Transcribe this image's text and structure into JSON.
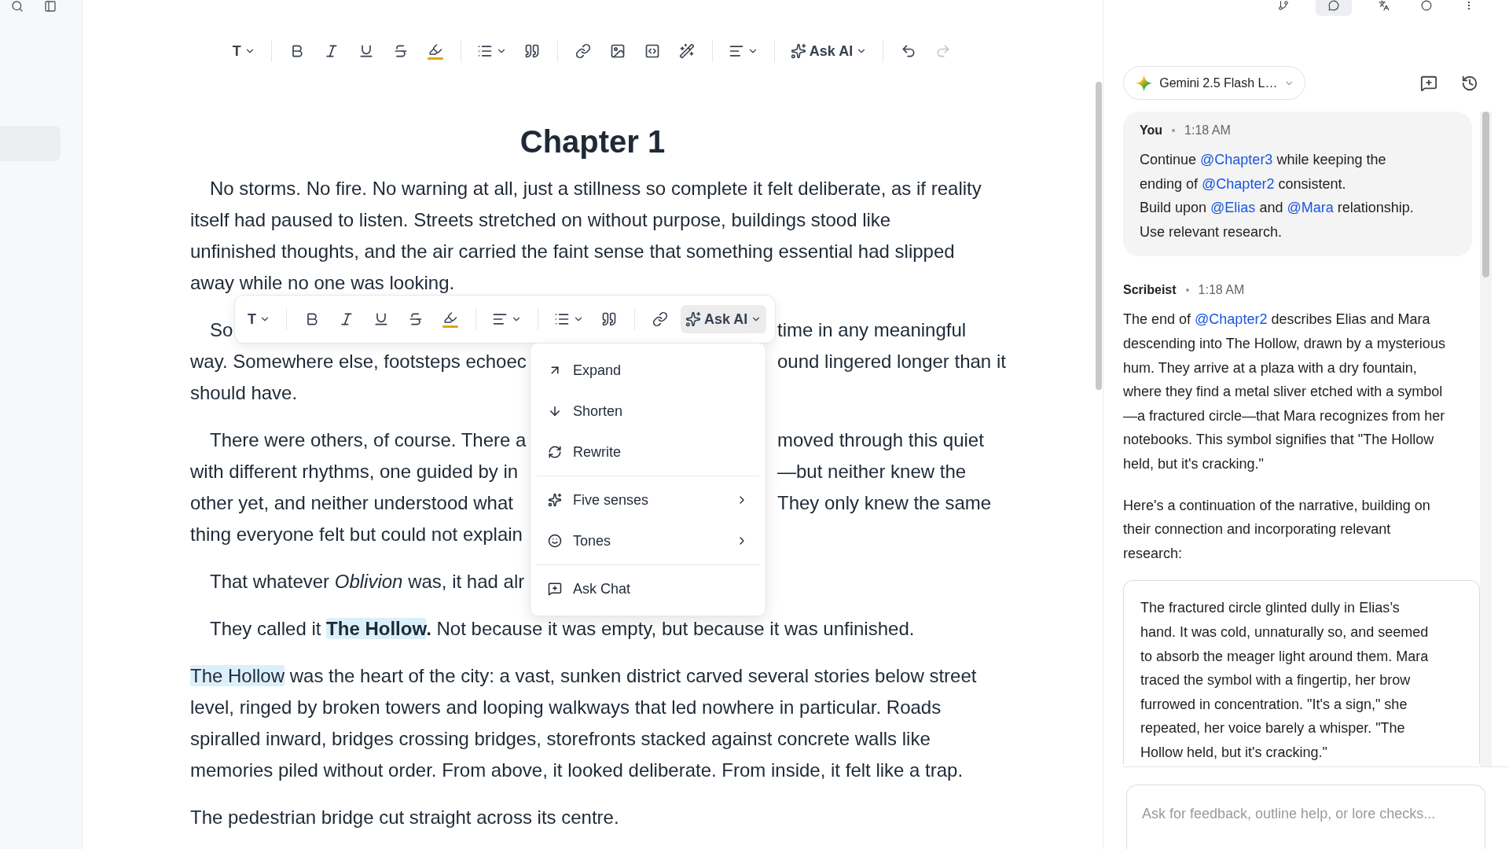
{
  "sidebar": {
    "items": [
      {
        "selected": true
      }
    ]
  },
  "top_icons": [
    {
      "kind": "branch",
      "selected": false
    },
    {
      "kind": "chat",
      "selected": true
    },
    {
      "kind": "text",
      "selected": false
    },
    {
      "kind": "circle",
      "selected": false
    },
    {
      "kind": "more",
      "selected": false
    }
  ],
  "toolbar": {
    "groups": [
      [
        {
          "kind": "text_style",
          "label": "T",
          "dropdown": true
        }
      ],
      [
        {
          "kind": "bold"
        },
        {
          "kind": "italic"
        },
        {
          "kind": "underline"
        },
        {
          "kind": "strike"
        },
        {
          "kind": "highlight"
        }
      ],
      [
        {
          "kind": "list",
          "dropdown": true
        },
        {
          "kind": "quote"
        }
      ],
      [
        {
          "kind": "link"
        },
        {
          "kind": "image"
        },
        {
          "kind": "code"
        },
        {
          "kind": "wand"
        }
      ],
      [
        {
          "kind": "align",
          "dropdown": true
        }
      ],
      [
        {
          "kind": "ask_ai",
          "label": "Ask AI",
          "dropdown": true,
          "selected": false
        }
      ],
      [
        {
          "kind": "undo",
          "disabled": false
        },
        {
          "kind": "redo",
          "disabled": true
        }
      ]
    ]
  },
  "document": {
    "title": "Chapter 1",
    "paragraphs": [
      {
        "kind": "full",
        "indent": true,
        "lines": [
          [
            {
              "text": "No storms. No fire. No warning at all, just a stillness so complete it felt deliberate, as if reality",
              "highlighted": false
            }
          ],
          [
            {
              "text": "itself had paused to listen. Streets stretched on without purpose, buildings stood like",
              "highlighted": false
            }
          ],
          [
            {
              "text": "unfinished thoughts, and the air carried the faint sense that something essential had slipped",
              "highlighted": false
            }
          ],
          [
            {
              "text": "away while no one was looking.",
              "highlighted": false
            }
          ]
        ]
      },
      {
        "kind": "covered",
        "indent": true,
        "lines": [
          {
            "left": "So",
            "right": "time in any meaningful"
          },
          {
            "left": "way. Somewhere else, footsteps echoec",
            "right": "ound lingered longer than it"
          },
          {
            "left": "should have."
          }
        ]
      },
      {
        "kind": "covered",
        "indent": true,
        "lines": [
          {
            "left": "There were others, of course. There a",
            "right": "moved through this quiet"
          },
          {
            "left": "with different rhythms, one guided by in",
            "right": "—but neither knew the"
          },
          {
            "left": "other yet, and neither understood what",
            "right": "They only knew the same"
          },
          {
            "left": "thing everyone felt but could not explain"
          }
        ]
      },
      {
        "kind": "covered",
        "indent": true,
        "lines": [
          {
            "left": "That whatever *Oblivion* was, it had alr"
          }
        ]
      },
      {
        "kind": "full",
        "indent": true,
        "lines": [
          [
            {
              "text": "They called it ",
              "highlighted": false
            },
            {
              "text": "**The Hollow**",
              "highlighted": true
            },
            {
              "text": "**.** Not because it was empty, but because it was unfinished.",
              "highlighted": false
            }
          ]
        ]
      },
      {
        "kind": "full",
        "indent": false,
        "lines": [
          [
            {
              "text": "The Hollow",
              "highlighted": true
            },
            {
              "text": " was the heart of the city: a vast, sunken district carved several stories below street",
              "highlighted": false
            }
          ],
          [
            {
              "text": "level, ringed by broken towers and looping walkways that led nowhere in particular. Roads",
              "highlighted": false
            }
          ],
          [
            {
              "text": "spiralled inward, bridges crossing bridges, storefronts stacked against concrete walls like",
              "highlighted": false
            }
          ],
          [
            {
              "text": "memories piled without order. From above, it looked deliberate. From inside, it felt like a trap.",
              "highlighted": false
            }
          ]
        ]
      },
      {
        "kind": "full",
        "indent": false,
        "lines": [
          [
            {
              "text": "The pedestrian bridge cut straight across its centre.",
              "highlighted": false
            }
          ]
        ]
      }
    ]
  },
  "floating_toolbar": {
    "groups": [
      [
        {
          "kind": "text_style",
          "label": "T",
          "dropdown": true
        }
      ],
      [
        {
          "kind": "bold"
        },
        {
          "kind": "italic"
        },
        {
          "kind": "underline"
        },
        {
          "kind": "strike"
        },
        {
          "kind": "highlight"
        }
      ],
      [
        {
          "kind": "align",
          "dropdown": true
        }
      ],
      [
        {
          "kind": "list",
          "dropdown": true
        },
        {
          "kind": "quote"
        }
      ],
      [
        {
          "kind": "link"
        },
        {
          "kind": "ask_ai",
          "label": "Ask AI",
          "dropdown": true,
          "selected": true
        }
      ]
    ]
  },
  "ai_menu": {
    "groups": [
      [
        {
          "kind": "expand",
          "label": "Expand",
          "submenu": false
        },
        {
          "kind": "shorten",
          "label": "Shorten",
          "submenu": false
        },
        {
          "kind": "rewrite",
          "label": "Rewrite",
          "submenu": false
        }
      ],
      [
        {
          "kind": "senses",
          "label": "Five senses",
          "submenu": true
        },
        {
          "kind": "tones",
          "label": "Tones",
          "submenu": true
        }
      ],
      [
        {
          "kind": "ask_chat",
          "label": "Ask Chat",
          "submenu": false
        }
      ]
    ]
  },
  "chat": {
    "model": {
      "label": "Gemini 2.5 Flash L…"
    },
    "messages": [
      {
        "kind": "user",
        "author": "You",
        "time": "1:18 AM",
        "paragraphs": [
          [
            [
              {
                "text": "Continue ",
                "mention": false
              },
              {
                "text": "@Chapter3",
                "mention": true
              },
              {
                "text": " while keeping the",
                "mention": false
              }
            ],
            [
              {
                "text": "ending of ",
                "mention": false
              },
              {
                "text": "@Chapter2",
                "mention": true
              },
              {
                "text": " consistent.",
                "mention": false
              }
            ],
            [
              {
                "text": "Build upon ",
                "mention": false
              },
              {
                "text": "@Elias",
                "mention": true
              },
              {
                "text": " and ",
                "mention": false
              },
              {
                "text": "@Mara",
                "mention": true
              },
              {
                "text": " relationship.",
                "mention": false
              }
            ],
            [
              {
                "text": "Use relevant research.",
                "mention": false
              }
            ]
          ]
        ]
      },
      {
        "kind": "assistant",
        "author": "Scribeist",
        "time": "1:18 AM",
        "paragraphs": [
          [
            [
              {
                "text": "The end of ",
                "mention": false
              },
              {
                "text": "@Chapter2",
                "mention": true
              },
              {
                "text": " describes Elias and Mara",
                "mention": false
              }
            ],
            [
              {
                "text": "descending into The Hollow, drawn by a mysterious",
                "mention": false
              }
            ],
            [
              {
                "text": "hum. They arrive at a plaza with a dry fountain,",
                "mention": false
              }
            ],
            [
              {
                "text": "where they find a metal sliver etched with a symbol",
                "mention": false
              }
            ],
            [
              {
                "text": "—a fractured circle—that Mara recognizes from her",
                "mention": false
              }
            ],
            [
              {
                "text": "notebooks. This symbol signifies that \"The Hollow",
                "mention": false
              }
            ],
            [
              {
                "text": "held, but it's cracking.\"",
                "mention": false
              }
            ]
          ],
          [
            [
              {
                "text": "Here's a continuation of the narrative, building on",
                "mention": false
              }
            ],
            [
              {
                "text": "their connection and incorporating relevant",
                "mention": false
              }
            ],
            [
              {
                "text": "research:",
                "mention": false
              }
            ]
          ]
        ],
        "quote": [
          "The fractured circle glinted dully in Elias’s",
          "hand. It was cold, unnaturally so, and seemed",
          "to absorb the meager light around them. Mara",
          "traced the symbol with a fingertip, her brow",
          "furrowed in concentration. \"It's a sign,\" she",
          "repeated, her voice barely a whisper. \"The",
          "Hollow held, but it's cracking.\""
        ]
      }
    ]
  },
  "input": {
    "placeholder": "Ask for feedback, outline help, or lore checks..."
  }
}
